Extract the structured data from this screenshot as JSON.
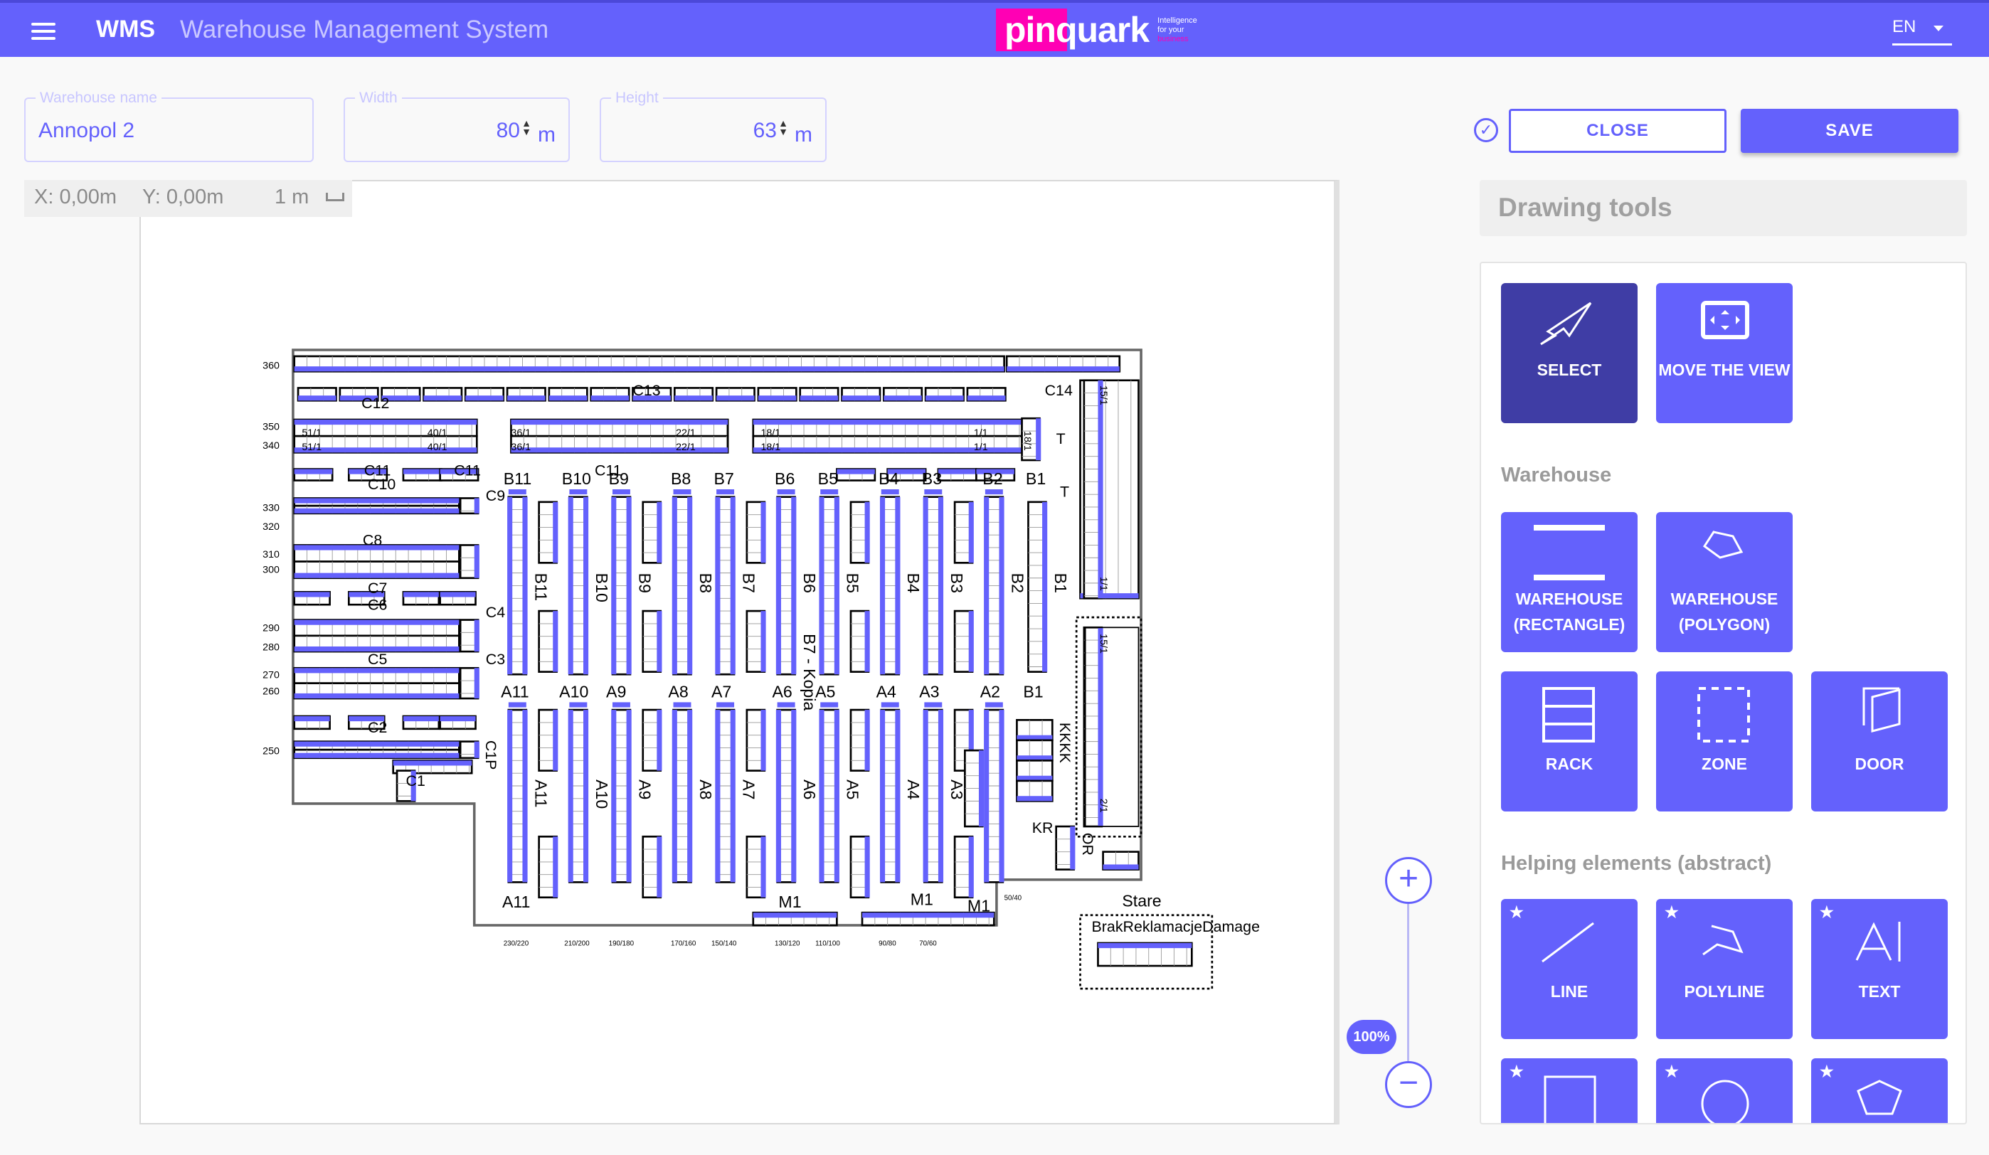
{
  "header": {
    "app_short": "WMS",
    "app_title": "Warehouse Management System",
    "logo_text": "pinquark",
    "logo_tagline": [
      "Intelligence",
      "for your",
      "business"
    ],
    "language": "EN"
  },
  "form": {
    "warehouse_name": {
      "label": "Warehouse name",
      "value": "Annopol 2"
    },
    "width": {
      "label": "Width",
      "value": "80",
      "unit": "m"
    },
    "height": {
      "label": "Height",
      "value": "63",
      "unit": "m"
    }
  },
  "actions": {
    "close": "CLOSE",
    "save": "SAVE"
  },
  "coords": {
    "x": "X: 0,00m",
    "y": "Y: 0,00m",
    "scale": "1 m"
  },
  "zoom": {
    "level": "100%",
    "plus": "+",
    "minus": "−"
  },
  "tools": {
    "title": "Drawing tools",
    "basic": [
      {
        "label": "SELECT",
        "icon": "cursor-arrow-icon",
        "active": true
      },
      {
        "label": "MOVE THE VIEW",
        "icon": "move-view-icon"
      }
    ],
    "warehouse_section": "Warehouse",
    "warehouse": [
      {
        "label": "WAREHOUSE (RECTANGLE)",
        "icon": "rectangle-icon"
      },
      {
        "label": "WAREHOUSE (POLYGON)",
        "icon": "polygon-icon"
      },
      {
        "label": "RACK",
        "icon": "rack-icon"
      },
      {
        "label": "ZONE",
        "icon": "zone-icon"
      },
      {
        "label": "DOOR",
        "icon": "door-icon"
      }
    ],
    "helping_section": "Helping elements (abstract)",
    "helping": [
      {
        "label": "LINE",
        "icon": "line-icon"
      },
      {
        "label": "POLYLINE",
        "icon": "polyline-icon"
      },
      {
        "label": "TEXT",
        "icon": "text-icon"
      },
      {
        "label": "",
        "icon": "square-icon"
      },
      {
        "label": "",
        "icon": "circle-icon"
      },
      {
        "label": "",
        "icon": "pentagon-icon"
      }
    ],
    "star": "★"
  },
  "floorplan": {
    "colors": {
      "rack_accent": "#6461fc",
      "rack_outline": "#000000"
    },
    "row_labels": [
      "360",
      "350",
      "340",
      "330",
      "320",
      "310",
      "300",
      "290",
      "280",
      "270",
      "260",
      "250"
    ],
    "bottom_labels": [
      "230/220",
      "210/200",
      "190/180",
      "170/160",
      "150/140",
      "130/120",
      "110/100",
      "90/80",
      "70/60",
      "50/40"
    ],
    "b_labels": [
      "B11",
      "B10",
      "B9",
      "B8",
      "B7",
      "B6",
      "B5",
      "B4",
      "B3",
      "B2",
      "B1"
    ],
    "a_labels": [
      "A11",
      "A10",
      "A9",
      "A8",
      "A7",
      "A6",
      "A5",
      "A4",
      "A3",
      "A2",
      "B1"
    ],
    "a_bottom_labels": [
      "A11",
      "M1",
      "M1",
      "M1"
    ],
    "rack_side_labels": [
      "B11",
      "B10",
      "B9",
      "B8",
      "B7",
      "B6",
      "B5",
      "B4",
      "B3",
      "B2",
      "B1",
      "A11",
      "A10",
      "A9",
      "A8",
      "A7",
      "A6",
      "A5",
      "A4",
      "A3"
    ],
    "b7_copy": "B7 - Kopia",
    "c_labels": [
      "C13",
      "C14",
      "C12",
      "C11",
      "C11",
      "C11",
      "C10",
      "C9",
      "C8",
      "C7",
      "C6",
      "C5",
      "C4",
      "C3",
      "C2",
      "C1",
      "C1P",
      "T",
      "T",
      "KR",
      "OR",
      "KKKK"
    ],
    "cell_labels": [
      "51/1",
      "51/1",
      "40/1",
      "40/1",
      "36/1",
      "36/1",
      "22/1",
      "22/1",
      "18/1",
      "18/1",
      "1/1",
      "1/1",
      "18/1",
      "15/1",
      "1/1",
      "15/1",
      "2/1"
    ],
    "zone": {
      "name": "Stare",
      "sub": "BrakReklamacjeDamage"
    }
  }
}
